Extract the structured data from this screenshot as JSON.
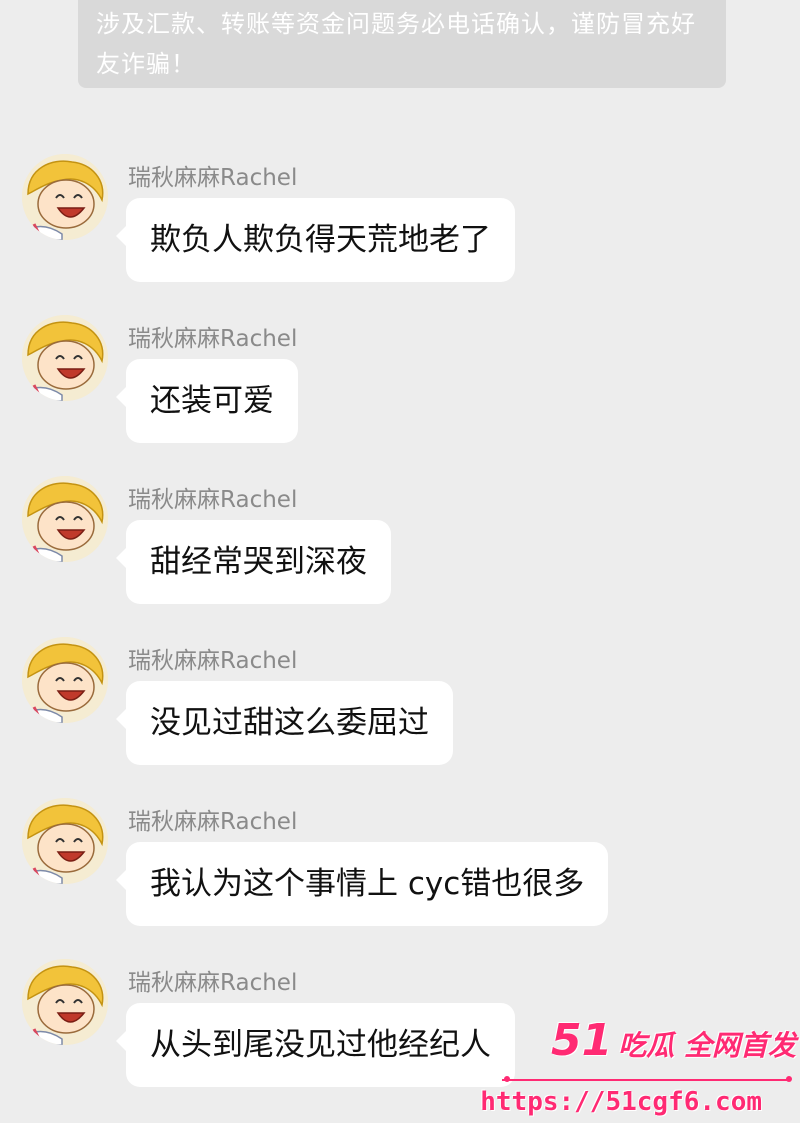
{
  "system_notice": {
    "text": "涉及汇款、转账等资金问题务必电话确认，谨防冒充好友诈骗！"
  },
  "messages": [
    {
      "sender": "瑞秋麻麻Rachel",
      "text": "欺负人欺负得天荒地老了"
    },
    {
      "sender": "瑞秋麻麻Rachel",
      "text": "还装可爱"
    },
    {
      "sender": "瑞秋麻麻Rachel",
      "text": "甜经常哭到深夜"
    },
    {
      "sender": "瑞秋麻麻Rachel",
      "text": "没见过甜这么委屈过"
    },
    {
      "sender": "瑞秋麻麻Rachel",
      "text": "我认为这个事情上 cyc错也很多"
    },
    {
      "sender": "瑞秋麻麻Rachel",
      "text": "从头到尾没见过他经纪人"
    }
  ],
  "avatar": {
    "icon": "cartoon-laughing-character-icon"
  },
  "watermark": {
    "brand_number": "51",
    "brand_text": "吃瓜 全网首发",
    "url": "https://51cgf6.com"
  },
  "colors": {
    "background": "#ededed",
    "bubble": "#ffffff",
    "notice_bg": "#d9d9d9",
    "sender_name": "#8a8a8a",
    "watermark": "#ff2a73"
  }
}
